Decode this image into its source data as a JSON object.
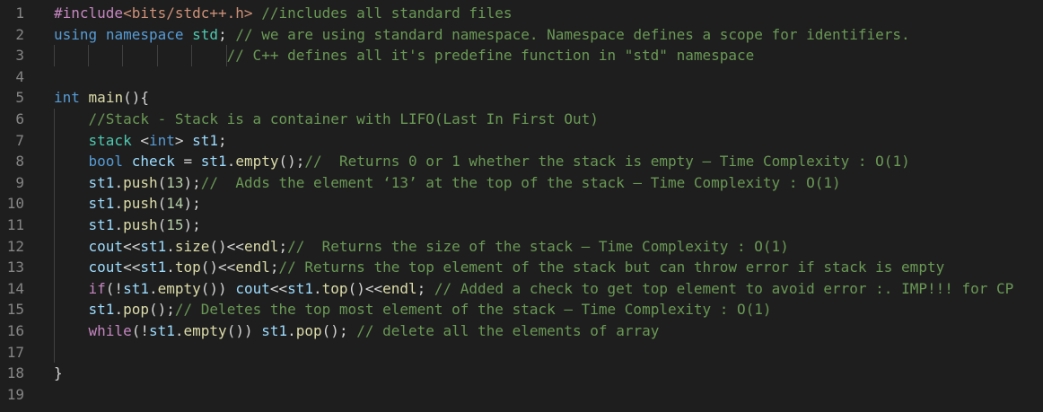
{
  "editor": {
    "lines": [
      {
        "n": "1",
        "tokens": [
          [
            "pp",
            "#include"
          ],
          [
            "inc",
            "<bits/stdc++.h>"
          ],
          [
            "pl",
            " "
          ],
          [
            "cm",
            "//includes all standard files"
          ]
        ]
      },
      {
        "n": "2",
        "tokens": [
          [
            "kw",
            "using"
          ],
          [
            "pl",
            " "
          ],
          [
            "kw",
            "namespace"
          ],
          [
            "pl",
            " "
          ],
          [
            "ty",
            "std"
          ],
          [
            "pl",
            "; "
          ],
          [
            "cm",
            "// we are using standard namespace. Namespace defines a scope for identifiers."
          ]
        ]
      },
      {
        "n": "3",
        "tokens": [
          [
            "pl",
            "                    "
          ],
          [
            "cm",
            "// C++ defines all it's predefine function in \"std\" namespace"
          ]
        ]
      },
      {
        "n": "4",
        "tokens": []
      },
      {
        "n": "5",
        "tokens": [
          [
            "kw",
            "int"
          ],
          [
            "pl",
            " "
          ],
          [
            "fn",
            "main"
          ],
          [
            "pl",
            "(){"
          ]
        ]
      },
      {
        "n": "6",
        "tokens": [
          [
            "pl",
            "    "
          ],
          [
            "cm",
            "//Stack - Stack is a container with LIFO(Last In First Out)"
          ]
        ]
      },
      {
        "n": "7",
        "tokens": [
          [
            "pl",
            "    "
          ],
          [
            "ty",
            "stack"
          ],
          [
            "pl",
            " <"
          ],
          [
            "kw",
            "int"
          ],
          [
            "pl",
            "> "
          ],
          [
            "var",
            "st1"
          ],
          [
            "pl",
            ";"
          ]
        ]
      },
      {
        "n": "8",
        "tokens": [
          [
            "pl",
            "    "
          ],
          [
            "kw",
            "bool"
          ],
          [
            "pl",
            " "
          ],
          [
            "var",
            "check"
          ],
          [
            "pl",
            " = "
          ],
          [
            "var",
            "st1"
          ],
          [
            "pl",
            "."
          ],
          [
            "fn",
            "empty"
          ],
          [
            "pl",
            "();"
          ],
          [
            "cm",
            "//  Returns 0 or 1 whether the stack is empty – Time Complexity : O(1)"
          ]
        ]
      },
      {
        "n": "9",
        "tokens": [
          [
            "pl",
            "    "
          ],
          [
            "var",
            "st1"
          ],
          [
            "pl",
            "."
          ],
          [
            "fn",
            "push"
          ],
          [
            "pl",
            "("
          ],
          [
            "num",
            "13"
          ],
          [
            "pl",
            ");"
          ],
          [
            "cm",
            "//  Adds the element ‘13’ at the top of the stack – Time Complexity : O(1)"
          ]
        ]
      },
      {
        "n": "10",
        "tokens": [
          [
            "pl",
            "    "
          ],
          [
            "var",
            "st1"
          ],
          [
            "pl",
            "."
          ],
          [
            "fn",
            "push"
          ],
          [
            "pl",
            "("
          ],
          [
            "num",
            "14"
          ],
          [
            "pl",
            ");"
          ]
        ]
      },
      {
        "n": "11",
        "tokens": [
          [
            "pl",
            "    "
          ],
          [
            "var",
            "st1"
          ],
          [
            "pl",
            "."
          ],
          [
            "fn",
            "push"
          ],
          [
            "pl",
            "("
          ],
          [
            "num",
            "15"
          ],
          [
            "pl",
            ");"
          ]
        ]
      },
      {
        "n": "12",
        "tokens": [
          [
            "pl",
            "    "
          ],
          [
            "var",
            "cout"
          ],
          [
            "pl",
            "<<"
          ],
          [
            "var",
            "st1"
          ],
          [
            "pl",
            "."
          ],
          [
            "fn",
            "size"
          ],
          [
            "pl",
            "()<<"
          ],
          [
            "fn",
            "endl"
          ],
          [
            "pl",
            ";"
          ],
          [
            "cm",
            "//  Returns the size of the stack – Time Complexity : O(1)"
          ]
        ]
      },
      {
        "n": "13",
        "tokens": [
          [
            "pl",
            "    "
          ],
          [
            "var",
            "cout"
          ],
          [
            "pl",
            "<<"
          ],
          [
            "var",
            "st1"
          ],
          [
            "pl",
            "."
          ],
          [
            "fn",
            "top"
          ],
          [
            "pl",
            "()<<"
          ],
          [
            "fn",
            "endl"
          ],
          [
            "pl",
            ";"
          ],
          [
            "cm",
            "// Returns the top element of the stack but can throw error if stack is empty"
          ]
        ]
      },
      {
        "n": "14",
        "tokens": [
          [
            "pl",
            "    "
          ],
          [
            "pp",
            "if"
          ],
          [
            "pl",
            "(!"
          ],
          [
            "var",
            "st1"
          ],
          [
            "pl",
            "."
          ],
          [
            "fn",
            "empty"
          ],
          [
            "pl",
            "()) "
          ],
          [
            "var",
            "cout"
          ],
          [
            "pl",
            "<<"
          ],
          [
            "var",
            "st1"
          ],
          [
            "pl",
            "."
          ],
          [
            "fn",
            "top"
          ],
          [
            "pl",
            "()<<"
          ],
          [
            "fn",
            "endl"
          ],
          [
            "pl",
            "; "
          ],
          [
            "cm",
            "// Added a check to get top element to avoid error :. IMP!!! for CP"
          ]
        ]
      },
      {
        "n": "15",
        "tokens": [
          [
            "pl",
            "    "
          ],
          [
            "var",
            "st1"
          ],
          [
            "pl",
            "."
          ],
          [
            "fn",
            "pop"
          ],
          [
            "pl",
            "();"
          ],
          [
            "cm",
            "// Deletes the top most element of the stack – Time Complexity : O(1)"
          ]
        ]
      },
      {
        "n": "16",
        "tokens": [
          [
            "pl",
            "    "
          ],
          [
            "pp",
            "while"
          ],
          [
            "pl",
            "(!"
          ],
          [
            "var",
            "st1"
          ],
          [
            "pl",
            "."
          ],
          [
            "fn",
            "empty"
          ],
          [
            "pl",
            "()) "
          ],
          [
            "var",
            "st1"
          ],
          [
            "pl",
            "."
          ],
          [
            "fn",
            "pop"
          ],
          [
            "pl",
            "(); "
          ],
          [
            "cm",
            "// delete all the elements of array"
          ]
        ]
      },
      {
        "n": "17",
        "tokens": []
      },
      {
        "n": "18",
        "tokens": [
          [
            "pl",
            "}"
          ]
        ]
      },
      {
        "n": "19",
        "tokens": []
      }
    ]
  }
}
